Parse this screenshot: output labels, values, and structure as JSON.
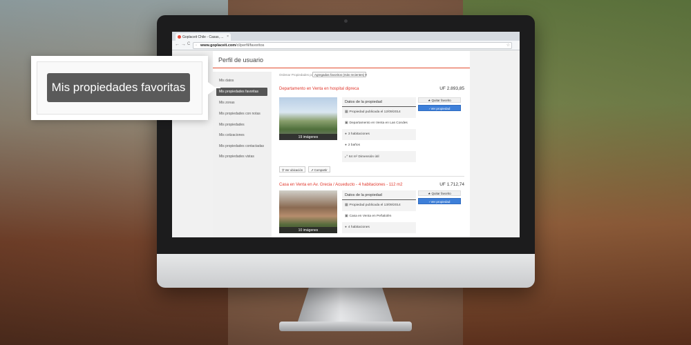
{
  "browser": {
    "tab_title": "Goplaceit Chile - Casas, ...",
    "tab_close": "×",
    "url_host": "www.goplaceit.com",
    "url_path": "/cl/perfil/favoritos",
    "back": "←",
    "forward": "→",
    "reload": "C",
    "star": "☆"
  },
  "page": {
    "title": "Perfil de usuario"
  },
  "sidebar": {
    "items": [
      {
        "label": "Mis datos"
      },
      {
        "label": "Mis propiedades favoritas"
      },
      {
        "label": "Mis zonas"
      },
      {
        "label": "Mis propiedades con notas"
      },
      {
        "label": "Mis propiedades"
      },
      {
        "label": "Mis cotizaciones"
      },
      {
        "label": "Mis propiedades contactadas"
      },
      {
        "label": "Mis propiedades vistas"
      }
    ]
  },
  "sort": {
    "label": "Ordenar Propiedades por:",
    "selected": "Agregadas favoritos (más recientes)"
  },
  "listings": [
    {
      "title": "Departamento en Venta en hospital dipreca",
      "price": "UF 2.893,85",
      "photo_caption": "19 imágenes",
      "details_title": "Datos de la propiedad",
      "rows": [
        "Propiedad publicada el 12/09/2014",
        "Departamento en Venta en Las Condes",
        "3 habitaciones",
        "2 baños",
        "64 m² Dimensión útil"
      ],
      "fav_button": "Quitar favorito",
      "view_button": "Ver propiedad",
      "location_button": "Ver ubicación",
      "share_button": "Compartir"
    },
    {
      "title": "Casa en Venta en Av. Grecia / Acueducto - 4 habitaciones - 112 m2",
      "price": "UF 1.712,74",
      "photo_caption": "10 imágenes",
      "details_title": "Datos de la propiedad",
      "rows": [
        "Propiedad publicada el 13/09/2014",
        "Casa en Venta en Peñalolén",
        "4 habitaciones"
      ],
      "fav_button": "Quitar favorito",
      "view_button": "Ver propiedad"
    }
  ],
  "callout": {
    "label": "Mis propiedades favoritas"
  }
}
